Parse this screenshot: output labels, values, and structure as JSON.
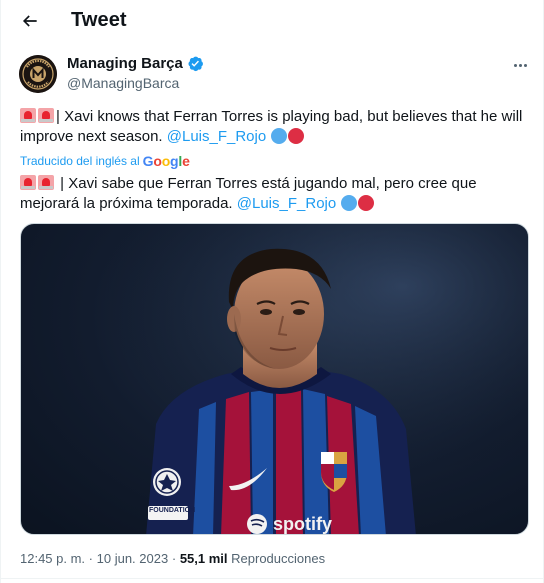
{
  "header": {
    "title": "Tweet"
  },
  "author": {
    "name": "Managing Barça",
    "handle": "@ManagingBarca",
    "verified": true,
    "avatar_text": "MANAGING BARÇA"
  },
  "translation": {
    "text_before": "| Xavi knows that Ferran Torres is playing bad, but believes that he will improve next season.",
    "mention": "@Luis_F_Rojo",
    "label": "Traducido del inglés al",
    "provider": "Google"
  },
  "original": {
    "text_before": "| Xavi sabe que Ferran Torres está jugando mal, pero cree que mejorará la próxima temporada.",
    "mention": "@Luis_F_Rojo"
  },
  "media": {
    "jersey_text": "spotify",
    "sleeve_badge": "FOUNDATION"
  },
  "meta": {
    "time": "12:45 p. m.",
    "separator": "·",
    "date": "10 jun. 2023",
    "views_count": "55,1 mil",
    "views_label": "Reproducciones"
  },
  "colors": {
    "link": "#1d9bf0",
    "text": "#0f1419",
    "secondary": "#536471",
    "verified": "#1d9bf0"
  }
}
